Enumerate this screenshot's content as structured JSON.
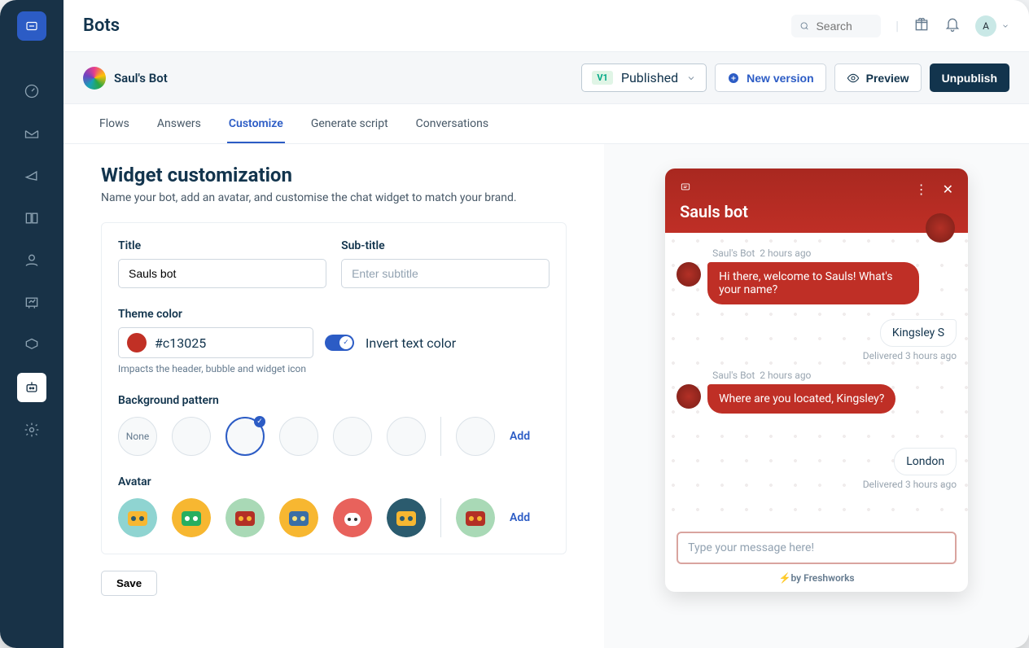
{
  "topbar": {
    "title": "Bots",
    "search_placeholder": "Search",
    "user_initial": "A"
  },
  "subhead": {
    "bot_name": "Saul's Bot",
    "version": "V1",
    "status": "Published",
    "new_version": "New version",
    "preview": "Preview",
    "unpublish": "Unpublish"
  },
  "tabs": [
    "Flows",
    "Answers",
    "Customize",
    "Generate script",
    "Conversations"
  ],
  "active_tab": 2,
  "page": {
    "title": "Widget customization",
    "desc": "Name your bot, add an avatar, and customise the chat widget to match your brand."
  },
  "form": {
    "title_label": "Title",
    "title_value": "Sauls bot",
    "subtitle_label": "Sub-title",
    "subtitle_placeholder": "Enter subtitle",
    "theme_label": "Theme color",
    "theme_value": "#c13025",
    "theme_hint": "Impacts the header, bubble and widget icon",
    "invert_label": "Invert text color",
    "bg_label": "Background pattern",
    "none_label": "None",
    "add_label": "Add",
    "avatar_label": "Avatar",
    "save_label": "Save"
  },
  "widget": {
    "title": "Sauls bot",
    "bot_name": "Saul's Bot",
    "msg1_time": "2 hours ago",
    "msg1_text": "Hi there, welcome to Sauls! What's your name?",
    "reply1": "Kingsley S",
    "reply1_meta": "Delivered  3 hours ago",
    "msg2_time": "2 hours ago",
    "msg2_text": "Where are you located, Kingsley?",
    "reply2": "London",
    "reply2_meta": "Delivered  3 hours ago",
    "input_placeholder": "Type your message here!",
    "footer_prefix": "by ",
    "footer_brand": "Freshworks"
  }
}
